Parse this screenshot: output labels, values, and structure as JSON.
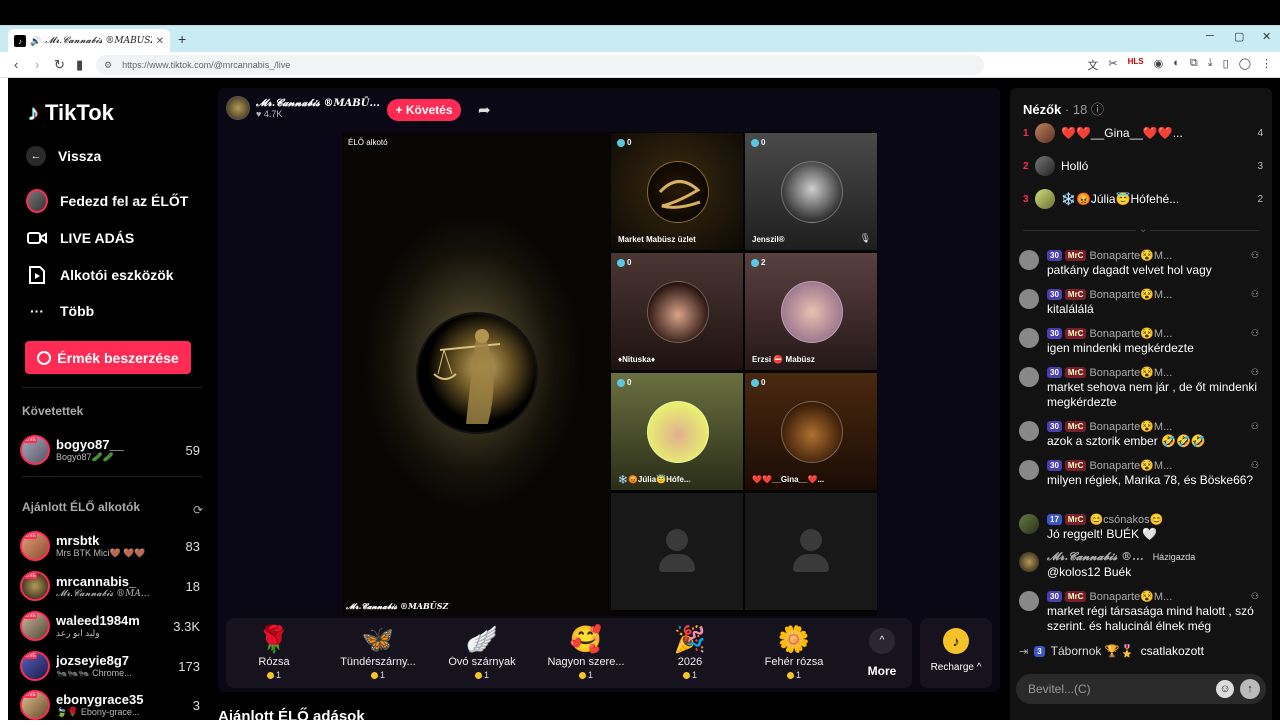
{
  "browser": {
    "tab_title": "𝓜𝓻.𝓒𝓪𝓷𝓷𝓪𝓫𝓲𝓼 ®MABŪSZ",
    "url": "https://www.tiktok.com/@mrcannabis_/live",
    "hls_label": "HLS"
  },
  "sidebar": {
    "logo": "TikTok",
    "back": "Vissza",
    "items": [
      {
        "label": "Fedezd fel az ÉLŐT",
        "icon": "avatar-icon"
      },
      {
        "label": "LIVE ADÁS",
        "icon": "camera-icon"
      },
      {
        "label": "Alkotói eszközök",
        "icon": "creator-tools-icon"
      },
      {
        "label": "Több",
        "icon": "more-dots-icon"
      }
    ],
    "coins_button": "Érmék beszerzése",
    "following_title": "Követettek",
    "following": [
      {
        "name": "bogyo87__",
        "sub": "Bogyó87🥒🥒",
        "count": "59"
      }
    ],
    "recommended_title": "Ajánlott ÉLŐ alkotók",
    "recommended": [
      {
        "name": "mrsbtk",
        "sub": "Mrs BTK Mici🤎 🤎🤎",
        "count": "83"
      },
      {
        "name": "mrcannabis_",
        "sub": "𝓜𝓻.𝓒𝓪𝓷𝓷𝓪𝓫𝓲𝓼 ®MA...",
        "count": "18"
      },
      {
        "name": "waleed1984m",
        "sub": "وليد ابو رعد",
        "count": "3.3K"
      },
      {
        "name": "jozseyie8g7",
        "sub": "🐜🐜🐜 Chrome...",
        "count": "173"
      },
      {
        "name": "ebonygrace35",
        "sub": "🍃🌹 Ebony-grace...",
        "count": "3"
      }
    ]
  },
  "stream": {
    "creator_name": "𝓜𝓻.𝓒𝓪𝓷𝓷𝓪𝓫𝓲𝓼 ®MABŪ...",
    "likes": "4.7K",
    "follow_label": "+ Követés",
    "host_label": "ÉLŐ alkotó",
    "host_bottom_name": "𝓜𝓻.𝓒𝓪𝓷𝓷𝓪𝓫𝓲𝓼 ®MABŪSZ",
    "guests": [
      {
        "name": "Market Mabüsz üzlet",
        "count": "0"
      },
      {
        "name": "Jenszil®",
        "count": "0"
      },
      {
        "name": "♦Nituska♦",
        "count": "0"
      },
      {
        "name": "Erzsi ⛔ Mabüsz",
        "count": "2"
      },
      {
        "name": "❄️😡Júlia😇Hófe...",
        "count": "0"
      },
      {
        "name": "❤️❤️__Gina__❤️...",
        "count": "0"
      }
    ]
  },
  "gifts": [
    {
      "name": "Rózsa",
      "price": "1",
      "icon": "🌹"
    },
    {
      "name": "Tündérszárny...",
      "price": "1",
      "icon": "🦋"
    },
    {
      "name": "Óvó szárnyak",
      "price": "1",
      "icon": "🪽"
    },
    {
      "name": "Nagyon szere...",
      "price": "1",
      "icon": "🥰"
    },
    {
      "name": "2026",
      "price": "1",
      "icon": "🎉"
    },
    {
      "name": "Fehér rózsa",
      "price": "1",
      "icon": "🌼"
    }
  ],
  "more_label": "More",
  "recharge_label": "Recharge ^",
  "recommend_heading": "Ajánlott ÉLŐ adások",
  "viewers": {
    "title": "Nézők",
    "count": "· 18",
    "top": [
      {
        "rank": "1",
        "name": "❤️❤️__Gina__❤️❤️...",
        "score": "4"
      },
      {
        "rank": "2",
        "name": "Holló",
        "score": "3"
      },
      {
        "rank": "3",
        "name": "❄️😡Júlia😇Hófehé...",
        "score": "2"
      }
    ]
  },
  "chat": [
    {
      "level": "30",
      "badge": "MrC",
      "user": "Bonaparte😵M...",
      "text": "patkány dagadt velvet hol vagy"
    },
    {
      "level": "30",
      "badge": "MrC",
      "user": "Bonaparte😵M...",
      "text": "kitalálálá"
    },
    {
      "level": "30",
      "badge": "MrC",
      "user": "Bonaparte😵M...",
      "text": "igen mindenki megkérdezte"
    },
    {
      "level": "30",
      "badge": "MrC",
      "user": "Bonaparte😵M...",
      "text": "market sehova nem jár , de őt mindenki megkérdezte"
    },
    {
      "level": "30",
      "badge": "MrC",
      "user": "Bonaparte😵M...",
      "text": "azok a sztorik ember 🤣🤣🤣"
    },
    {
      "level": "30",
      "badge": "MrC",
      "user": "Bonaparte😵M...",
      "text": "milyen régiek, Marika 78, és Böske66?"
    },
    {
      "level": "17",
      "badge": "MrC",
      "user": "😊csónakos😊",
      "text": "Jó reggelt! BUÉK 🤍"
    },
    {
      "level": "",
      "badge": "",
      "user": "𝓜𝓻.𝓒𝓪𝓷𝓷𝓪𝓫𝓲𝓼 ®...",
      "host_tag": "Házigazda",
      "text": "@kolos12 Buék"
    },
    {
      "level": "30",
      "badge": "MrC",
      "user": "Bonaparte😵M...",
      "text": "market régi társasága mind halott , szó szerint. és halucinál élnek még"
    }
  ],
  "joined": {
    "level": "3",
    "user": "Tábornok 🏆🎖️",
    "action": "csatlakozott"
  },
  "chat_input_placeholder": "Bevitel...(C)"
}
